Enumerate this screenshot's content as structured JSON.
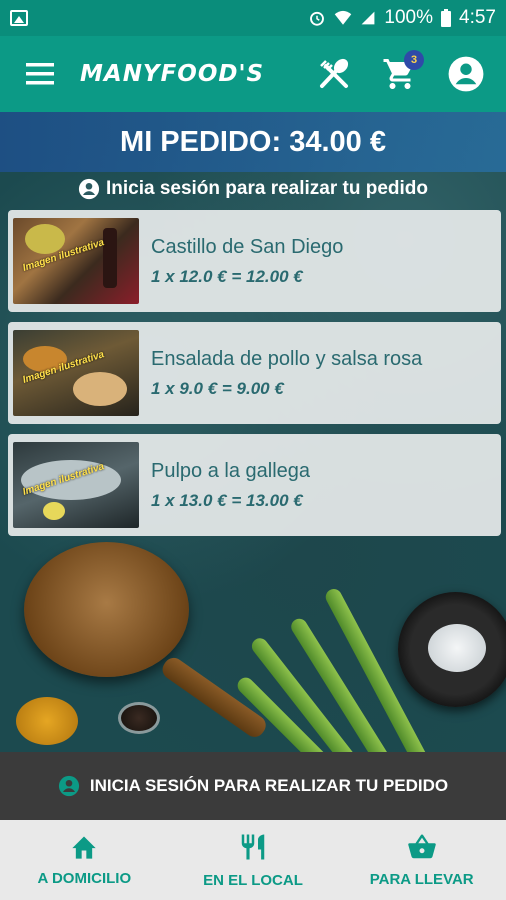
{
  "status_bar": {
    "battery": "100%",
    "time": "4:57"
  },
  "app_bar": {
    "title": "MANYFOOD'S",
    "cart_count": "3"
  },
  "order": {
    "title": "MI PEDIDO: 34.00 €",
    "login_hint": "Inicia sesión para realizar tu pedido"
  },
  "items": [
    {
      "name": "Castillo de San Diego",
      "price_line": "1 x 12.0 € = 12.00 €",
      "image_tag": "Imagen ilustrativa"
    },
    {
      "name": "Ensalada de pollo y salsa rosa",
      "price_line": "1 x 9.0 € = 9.00 €",
      "image_tag": "Imagen ilustrativa"
    },
    {
      "name": "Pulpo a la gallega",
      "price_line": "1 x 13.0 € = 13.00 €",
      "image_tag": "Imagen ilustrativa"
    }
  ],
  "login_banner": {
    "label": "INICIA SESIÓN PARA REALIZAR TU PEDIDO"
  },
  "bottom_nav": [
    {
      "label": "A DOMICILIO",
      "icon": "home-icon"
    },
    {
      "label": "EN EL LOCAL",
      "icon": "cutlery-icon"
    },
    {
      "label": "PARA LLEVAR",
      "icon": "basket-icon"
    }
  ],
  "colors": {
    "primary": "#0c9a86",
    "card_text": "#2a6a70",
    "banner": "#3b3b3b",
    "nav_bg": "#e9e9e9",
    "badge": "#2f4aa8"
  }
}
